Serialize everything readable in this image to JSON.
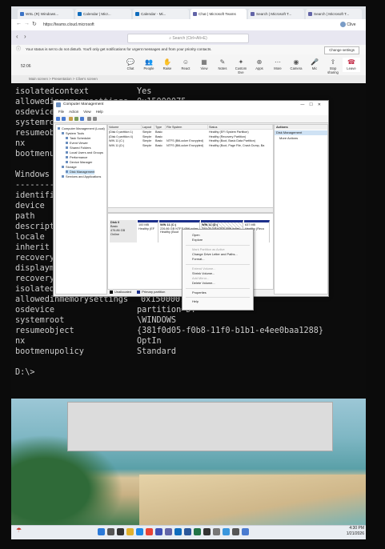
{
  "browser": {
    "tabs": [
      {
        "label": "WSL (R) Windows...",
        "color": "#3b73c6"
      },
      {
        "label": "Calendar | Micr...",
        "color": "#0f6cbd"
      },
      {
        "label": "Calendar - Mi...",
        "color": "#0f6cbd"
      },
      {
        "label": "Chat | Microsoft Teams",
        "color": "#6264a7"
      },
      {
        "label": "Search | Microsoft T...",
        "color": "#6264a7"
      },
      {
        "label": "Search | Microsoft T...",
        "color": "#6264a7"
      }
    ],
    "url": "https://teams.cloud.microsoft",
    "profile": "Clive"
  },
  "teams": {
    "search_placeholder": "Search (Ctrl+Alt+E)",
    "notice": "Your status is set to do not disturb. You'll only get notifications for urgent messages and from your priority contacts.",
    "notice_button": "Change settings",
    "timer": "52:06",
    "tools": [
      {
        "label": "Chat",
        "icon": "💬"
      },
      {
        "label": "People",
        "icon": "👥"
      },
      {
        "label": "Raise",
        "icon": "✋"
      },
      {
        "label": "React",
        "icon": "☺"
      },
      {
        "label": "View",
        "icon": "▦"
      },
      {
        "label": "Notes",
        "icon": "✎"
      },
      {
        "label": "Custom Eve",
        "icon": "✦"
      },
      {
        "label": "Apps",
        "icon": "⊕"
      },
      {
        "label": "More",
        "icon": "⋯"
      },
      {
        "label": "Camera",
        "icon": "◉"
      },
      {
        "label": "Mic",
        "icon": "🎤"
      },
      {
        "label": "Stop sharing",
        "icon": "⇪"
      },
      {
        "label": "Leave",
        "icon": "☎"
      }
    ],
    "breadcrumb": "Main screen > Presentation > Clive's screen"
  },
  "console": {
    "top_lines": [
      {
        "key": "isolatedcontext",
        "value": "Yes"
      },
      {
        "key": "allowedinmemorysettings",
        "value": "0x15000075"
      },
      {
        "key": "osdevice",
        "value": ""
      },
      {
        "key": "systemroot",
        "value": ""
      },
      {
        "key": "resumeob",
        "value": ""
      },
      {
        "key": "nx",
        "value": ""
      },
      {
        "key": "bootmenu",
        "value": ""
      }
    ],
    "section_title": "Windows",
    "section_dashes": "--------",
    "mid_lines": [
      {
        "key": "identifi",
        "value": ""
      },
      {
        "key": "device",
        "value": ""
      },
      {
        "key": "path",
        "value": ""
      },
      {
        "key": "descript",
        "value": ""
      },
      {
        "key": "locale",
        "value": ""
      },
      {
        "key": "inherit",
        "value": ""
      },
      {
        "key": "recovery",
        "value": ""
      },
      {
        "key": "displaym",
        "value": ""
      },
      {
        "key": "recovery",
        "value": ""
      },
      {
        "key": "isolated",
        "value": ""
      }
    ],
    "bottom_lines": [
      {
        "key": "allowedinmemorysettings",
        "value": "0x15000075"
      },
      {
        "key": "osdevice",
        "value": "partition=D:"
      },
      {
        "key": "systemroot",
        "value": "\\WINDOWS"
      },
      {
        "key": "resumeobject",
        "value": "{381f0d05-f0b8-11f0-b1b1-e4ee0baa1288}"
      },
      {
        "key": "nx",
        "value": "OptIn"
      },
      {
        "key": "bootmenupolicy",
        "value": "Standard"
      }
    ],
    "prompt": "D:\\>"
  },
  "cm": {
    "title": "Computer Management",
    "menu": [
      "File",
      "Action",
      "View",
      "Help"
    ],
    "tree": [
      {
        "label": "Computer Management (Local)",
        "indent": 0
      },
      {
        "label": "System Tools",
        "indent": 1
      },
      {
        "label": "Task Scheduler",
        "indent": 2
      },
      {
        "label": "Event Viewer",
        "indent": 2
      },
      {
        "label": "Shared Folders",
        "indent": 2
      },
      {
        "label": "Local Users and Groups",
        "indent": 2
      },
      {
        "label": "Performance",
        "indent": 2
      },
      {
        "label": "Device Manager",
        "indent": 2
      },
      {
        "label": "Storage",
        "indent": 1
      },
      {
        "label": "Disk Management",
        "indent": 2
      },
      {
        "label": "Services and Applications",
        "indent": 1
      }
    ],
    "vol_headers": [
      "Volume",
      "Layout",
      "Type",
      "File System",
      "Status"
    ],
    "volumes": [
      [
        "(Disk 0 partition 1)",
        "Simple",
        "Basic",
        "",
        "Healthy (EFI System Partition)"
      ],
      [
        "(Disk 0 partition 4)",
        "Simple",
        "Basic",
        "",
        "Healthy (Recovery Partition)"
      ],
      [
        "WIN 11 (C:)",
        "Simple",
        "Basic",
        "NTFS (BitLocker Encrypted)",
        "Healthy (Boot, Basic Data Partition)"
      ],
      [
        "WIN 11 (D:)",
        "Simple",
        "Basic",
        "NTFS (BitLocker Encrypted)",
        "Healthy (Boot, Page File, Crash Dump, Ba"
      ]
    ],
    "disk": {
      "name": "Disk 0",
      "type": "Basic",
      "size": "476.86 GB",
      "status": "Online"
    },
    "partitions": [
      {
        "title": "",
        "size": "100 MB",
        "status": "Healthy (EF"
      },
      {
        "title": "WIN 11 (C:)",
        "size": "226.86 GB NTFS (BitLocker",
        "status": "Healthy (Boot"
      },
      {
        "title": "WIN 11 (D:)",
        "size": "234.03 GB NTFS (BitLocker E",
        "status": "Healthy (Boot, Pa"
      },
      {
        "title": "",
        "size": "637 MB",
        "status": "Healthy (Reco"
      }
    ],
    "legend": [
      "Unallocated",
      "Primary partition"
    ],
    "actions_header": "Actions",
    "actions_selected": "Disk Management",
    "actions_more": "More Actions"
  },
  "context_menu": [
    {
      "label": "Open",
      "disabled": false
    },
    {
      "label": "Explore",
      "disabled": false
    },
    {
      "sep": true
    },
    {
      "label": "Mark Partition as Active",
      "disabled": true
    },
    {
      "label": "Change Drive Letter and Paths...",
      "disabled": false
    },
    {
      "label": "Format...",
      "disabled": false
    },
    {
      "sep": true
    },
    {
      "label": "Extend Volume...",
      "disabled": true
    },
    {
      "label": "Shrink Volume...",
      "disabled": false
    },
    {
      "label": "Add Mirror...",
      "disabled": true
    },
    {
      "label": "Delete Volume...",
      "disabled": false
    },
    {
      "sep": true
    },
    {
      "label": "Properties",
      "disabled": false
    },
    {
      "sep": true
    },
    {
      "label": "Help",
      "disabled": false
    }
  ],
  "taskbar": {
    "time": "4:30 PM",
    "date": "1/21/2026",
    "icons": [
      "start-icon",
      "search-icon",
      "taskview-icon",
      "explorer-icon",
      "edge-icon",
      "chrome-icon",
      "store-icon",
      "teams-icon",
      "outlook-icon",
      "word-icon",
      "excel-icon",
      "terminal-icon",
      "settings-icon",
      "photos-icon",
      "calc-icon",
      "mgmt-icon"
    ]
  }
}
